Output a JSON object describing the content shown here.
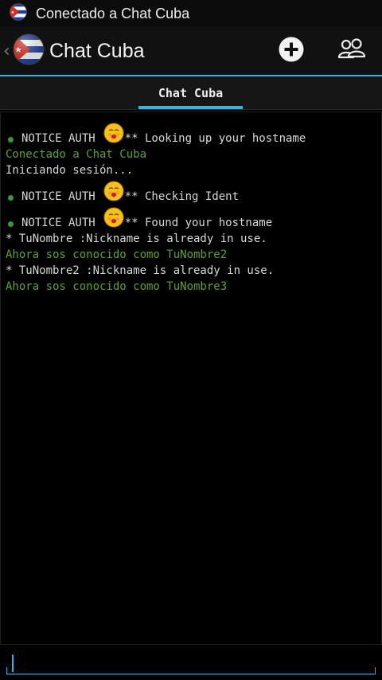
{
  "status_bar": {
    "title": "Conectado a Chat Cuba",
    "icon": "cuba-flag-icon"
  },
  "action_bar": {
    "title": "Chat Cuba",
    "up_icon": "back-caret-icon",
    "app_icon": "cuba-flag-icon",
    "actions": [
      {
        "name": "add-icon"
      },
      {
        "name": "users-icon"
      }
    ]
  },
  "tabs": [
    {
      "label": "Chat Cuba",
      "selected": true
    }
  ],
  "messages": [
    {
      "type": "notice",
      "prefix": "NOTICE AUTH",
      "text": "** Looking up your hostname"
    },
    {
      "type": "info",
      "text": "Conectado a Chat Cuba"
    },
    {
      "type": "plain",
      "text": "Iniciando sesión..."
    },
    {
      "type": "notice",
      "prefix": "NOTICE AUTH",
      "text": "** Checking Ident"
    },
    {
      "type": "notice",
      "prefix": "NOTICE AUTH",
      "text": "** Found your hostname"
    },
    {
      "type": "plain",
      "text": "* TuNombre :Nickname is already in use."
    },
    {
      "type": "info",
      "text": "Ahora sos conocido como TuNombre2"
    },
    {
      "type": "plain",
      "text": "* TuNombre2 :Nickname is already in use."
    },
    {
      "type": "info",
      "text": "Ahora sos conocido como TuNombre3"
    }
  ],
  "input": {
    "value": ""
  },
  "colors": {
    "accent": "#33b5e5",
    "info_text": "#5fa03a",
    "plain_text": "#d8d8d8",
    "background": "#000000"
  }
}
